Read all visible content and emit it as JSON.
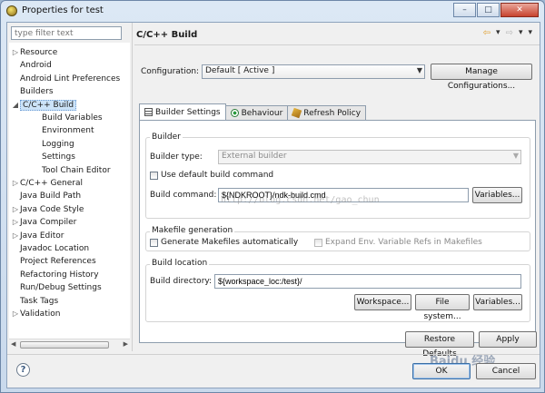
{
  "window": {
    "title": "Properties for test",
    "btn_min": "–",
    "btn_max": "□",
    "btn_close": "✕"
  },
  "filter": {
    "placeholder": "type filter text"
  },
  "tree": {
    "items": [
      {
        "label": "Resource",
        "expand": "▷",
        "indent": 0,
        "selected": false
      },
      {
        "label": "Android",
        "expand": "",
        "indent": 0,
        "selected": false
      },
      {
        "label": "Android Lint Preferences",
        "expand": "",
        "indent": 0,
        "selected": false
      },
      {
        "label": "Builders",
        "expand": "",
        "indent": 0,
        "selected": false
      },
      {
        "label": "C/C++ Build",
        "expand": "◢",
        "indent": 0,
        "selected": true
      },
      {
        "label": "Build Variables",
        "expand": "",
        "indent": 1,
        "selected": false
      },
      {
        "label": "Environment",
        "expand": "",
        "indent": 1,
        "selected": false
      },
      {
        "label": "Logging",
        "expand": "",
        "indent": 1,
        "selected": false
      },
      {
        "label": "Settings",
        "expand": "",
        "indent": 1,
        "selected": false
      },
      {
        "label": "Tool Chain Editor",
        "expand": "",
        "indent": 1,
        "selected": false
      },
      {
        "label": "C/C++ General",
        "expand": "▷",
        "indent": 0,
        "selected": false
      },
      {
        "label": "Java Build Path",
        "expand": "",
        "indent": 0,
        "selected": false
      },
      {
        "label": "Java Code Style",
        "expand": "▷",
        "indent": 0,
        "selected": false
      },
      {
        "label": "Java Compiler",
        "expand": "▷",
        "indent": 0,
        "selected": false
      },
      {
        "label": "Java Editor",
        "expand": "▷",
        "indent": 0,
        "selected": false
      },
      {
        "label": "Javadoc Location",
        "expand": "",
        "indent": 0,
        "selected": false
      },
      {
        "label": "Project References",
        "expand": "",
        "indent": 0,
        "selected": false
      },
      {
        "label": "Refactoring History",
        "expand": "",
        "indent": 0,
        "selected": false
      },
      {
        "label": "Run/Debug Settings",
        "expand": "",
        "indent": 0,
        "selected": false
      },
      {
        "label": "Task Tags",
        "expand": "",
        "indent": 0,
        "selected": false
      },
      {
        "label": "Validation",
        "expand": "▷",
        "indent": 0,
        "selected": false
      }
    ],
    "scroll_left": "◀",
    "scroll_right": "▶"
  },
  "page": {
    "title": "C/C++ Build",
    "nav_back": "⇦",
    "nav_fwd": "⇨",
    "nav_menu": "▾"
  },
  "config": {
    "label": "Configuration:",
    "value": "Default  [ Active ]",
    "manage_label": "Manage Configurations..."
  },
  "tabs": [
    {
      "label": "Builder Settings",
      "icon": "builder-settings-icon"
    },
    {
      "label": "Behaviour",
      "icon": "behaviour-icon"
    },
    {
      "label": "Refresh Policy",
      "icon": "refresh-policy-icon"
    }
  ],
  "builder": {
    "group_label": "Builder",
    "type_label": "Builder type:",
    "type_value": "External builder",
    "use_default_label": "Use default build command",
    "command_label": "Build command:",
    "command_value": "${NDKROOT}/ndk-build.cmd",
    "variables_label": "Variables..."
  },
  "makefile": {
    "group_label": "Makefile generation",
    "generate_label": "Generate Makefiles automatically",
    "expand_label": "Expand Env. Variable Refs in Makefiles"
  },
  "location": {
    "group_label": "Build location",
    "dir_label": "Build directory:",
    "dir_value": "${workspace_loc:/test}/",
    "workspace_label": "Workspace...",
    "filesystem_label": "File system...",
    "variables_label": "Variables..."
  },
  "watermark": "http://blog.csdn.net/gao_chun",
  "baidu_watermark": "Baidu 经验",
  "footer": {
    "help": "?",
    "restore_label": "Restore Defaults",
    "apply_label": "Apply",
    "ok_label": "OK",
    "cancel_label": "Cancel"
  }
}
